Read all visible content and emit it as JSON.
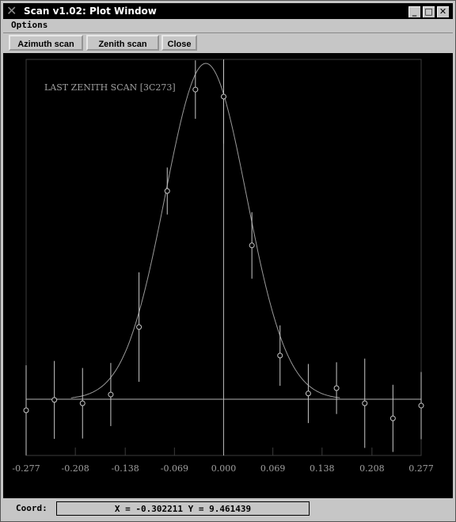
{
  "window": {
    "title": "Scan v1.02: Plot Window",
    "app_icon": "x-logo-icon",
    "controls": [
      "minimize",
      "maximize",
      "close"
    ],
    "minimize_glyph": "_",
    "maximize_glyph": "□",
    "close_glyph": "✕"
  },
  "menu": {
    "items": [
      {
        "label": "Options"
      }
    ]
  },
  "toolbar": {
    "azimuth_label": "Azimuth scan",
    "zenith_label": "Zenith scan",
    "close_label": "Close"
  },
  "status": {
    "coord_label": "Coord:",
    "coord_value": "X = -0.302211   Y = 9.461439"
  },
  "colors": {
    "plot_bg": "#000000",
    "axis": "#b4b4b4",
    "frame": "#3c3c3c",
    "data": "#c8c8c8",
    "fit": "#9a9a9a",
    "label": "#a0a0a0"
  },
  "chart_data": {
    "type": "scatter",
    "title": "LAST ZENITH SCAN [3C273]",
    "title_position": "top-left",
    "xlabel": "",
    "ylabel": "",
    "xlim": [
      -0.277,
      0.277
    ],
    "ylim_normalized": [
      -0.168,
      1.02
    ],
    "y_units": "normalized (peak = 1)",
    "grid": false,
    "legend": "none",
    "x_ticks": [
      -0.277,
      -0.208,
      -0.138,
      -0.069,
      0.0,
      0.069,
      0.138,
      0.208,
      0.277
    ],
    "x_tick_labels": [
      "-0.277",
      "-0.208",
      "-0.138",
      "-0.069",
      "0.000",
      "0.069",
      "0.138",
      "0.208",
      "0.277"
    ],
    "series": [
      {
        "name": "measurements",
        "kind": "points-with-errorbars",
        "x": [
          -0.277,
          -0.2374,
          -0.1979,
          -0.1583,
          -0.1187,
          -0.0791,
          -0.0396,
          0.0,
          0.0396,
          0.0791,
          0.1187,
          0.1583,
          0.1979,
          0.2374,
          0.277
        ],
        "y": [
          -0.033,
          -0.002,
          -0.012,
          0.014,
          0.215,
          0.62,
          0.922,
          0.901,
          0.458,
          0.13,
          0.017,
          0.033,
          -0.012,
          -0.057,
          -0.019
        ],
        "err": [
          0.134,
          0.116,
          0.105,
          0.094,
          0.163,
          0.07,
          0.087,
          0.14,
          0.099,
          0.09,
          0.088,
          0.077,
          0.133,
          0.1,
          0.1
        ]
      },
      {
        "name": "gaussian-fit",
        "kind": "line",
        "amplitude": 1.0,
        "center": -0.025,
        "sigma": 0.057,
        "x_range": [
          -0.214,
          0.163
        ]
      }
    ],
    "reference_lines": {
      "horizontal_y": 0,
      "vertical_x": 0
    }
  }
}
